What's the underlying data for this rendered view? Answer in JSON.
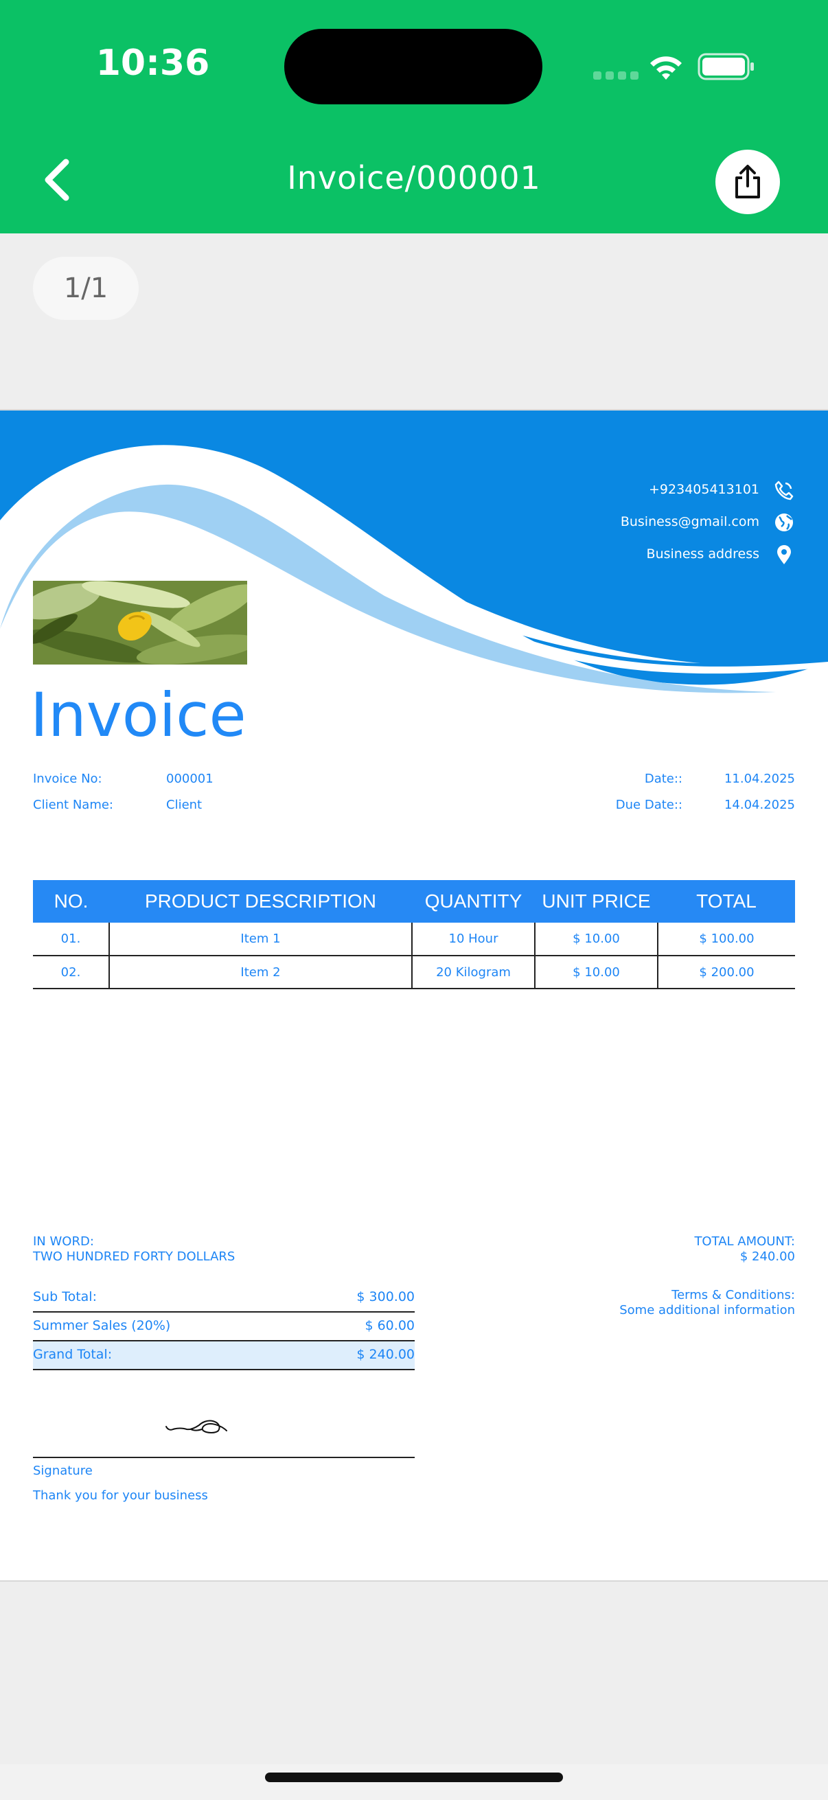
{
  "status_bar": {
    "time": "10:36"
  },
  "header": {
    "title": "Invoice/000001"
  },
  "pager": {
    "label": "1/1"
  },
  "invoice": {
    "contact": {
      "phone": "+923405413101",
      "email": "Business@gmail.com",
      "address": "Business address"
    },
    "title": "Invoice",
    "invoice_no_label": "Invoice No:",
    "invoice_no": "000001",
    "client_name_label": "Client Name:",
    "client_name": "Client",
    "date_label": "Date::",
    "date": "11.04.2025",
    "due_date_label": "Due Date::",
    "due_date": "14.04.2025",
    "table": {
      "headers": [
        "NO.",
        "PRODUCT DESCRIPTION",
        "QUANTITY",
        "UNIT PRICE",
        "TOTAL"
      ],
      "rows": [
        [
          "01.",
          "Item 1",
          "10 Hour",
          "$ 10.00",
          "$ 100.00"
        ],
        [
          "02.",
          "Item 2",
          "20 Kilogram",
          "$ 10.00",
          "$ 200.00"
        ]
      ]
    },
    "in_word_label": "IN WORD:",
    "in_word": "TWO HUNDRED FORTY DOLLARS",
    "total_amount_label": "TOTAL AMOUNT:",
    "total_amount": "$ 240.00",
    "terms_label": "Terms & Conditions:",
    "terms": "Some additional information",
    "summary": [
      {
        "label": "Sub Total:",
        "value": "$ 300.00"
      },
      {
        "label": "Summer Sales (20%)",
        "value": "$ 60.00"
      },
      {
        "label": "Grand Total:",
        "value": "$ 240.00"
      }
    ],
    "signature_label": "Signature",
    "thank_you": "Thank you for your business"
  },
  "colors": {
    "header_green": "#0bc165",
    "invoice_blue": "#2189f6",
    "wave_blue": "#0a88e2",
    "wave_light": "#9fd0f3",
    "grand_total_bg": "#deeefc"
  },
  "icons": [
    "back-chevron-icon",
    "share-icon",
    "phone-icon",
    "globe-icon",
    "location-pin-icon",
    "wifi-icon",
    "battery-icon"
  ]
}
